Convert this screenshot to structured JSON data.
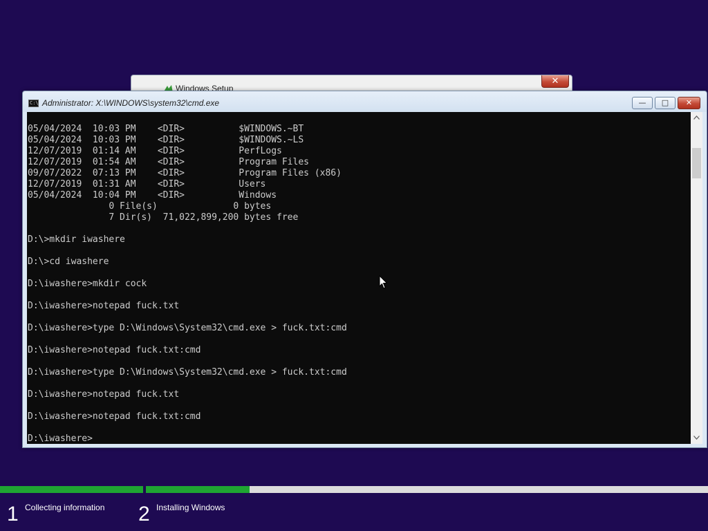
{
  "setup_window": {
    "title": "Windows Setup",
    "close_label": "✕"
  },
  "cmd_window": {
    "title": "Administrator: X:\\WINDOWS\\system32\\cmd.exe",
    "minimize_label": "—",
    "maximize_label": "□",
    "close_label": "✕",
    "icon_label": "C:\\"
  },
  "console": {
    "lines": [
      "05/04/2024  10:03 PM    <DIR>          $WINDOWS.~BT",
      "05/04/2024  10:03 PM    <DIR>          $WINDOWS.~LS",
      "12/07/2019  01:14 AM    <DIR>          PerfLogs",
      "12/07/2019  01:54 AM    <DIR>          Program Files",
      "09/07/2022  07:13 PM    <DIR>          Program Files (x86)",
      "12/07/2019  01:31 AM    <DIR>          Users",
      "05/04/2024  10:04 PM    <DIR>          Windows",
      "               0 File(s)              0 bytes",
      "               7 Dir(s)  71,022,899,200 bytes free",
      "",
      "D:\\>mkdir iwashere",
      "",
      "D:\\>cd iwashere",
      "",
      "D:\\iwashere>mkdir cock",
      "",
      "D:\\iwashere>notepad fuck.txt",
      "",
      "D:\\iwashere>type D:\\Windows\\System32\\cmd.exe > fuck.txt:cmd",
      "",
      "D:\\iwashere>notepad fuck.txt:cmd",
      "",
      "D:\\iwashere>type D:\\Windows\\System32\\cmd.exe > fuck.txt:cmd",
      "",
      "D:\\iwashere>notepad fuck.txt",
      "",
      "D:\\iwashere>notepad fuck.txt:cmd",
      "",
      "D:\\iwashere>"
    ]
  },
  "setup_progress": {
    "colors": {
      "background": "#1e0a52",
      "progress_fill": "#1fa532",
      "track": "#dcdcdc"
    },
    "steps": [
      {
        "number": "1",
        "label": "Collecting information",
        "state": "complete"
      },
      {
        "number": "2",
        "label": "Installing Windows",
        "state": "in-progress"
      }
    ]
  }
}
